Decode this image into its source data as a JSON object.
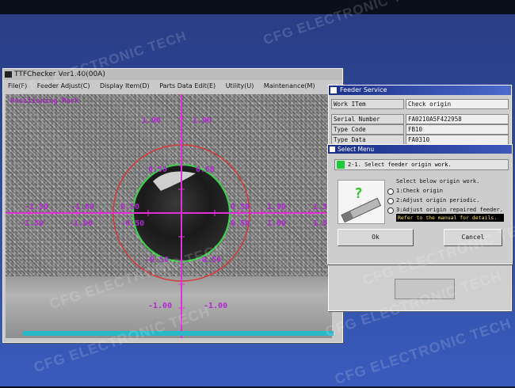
{
  "window": {
    "title": "TTFChecker Ver1.40(00A)",
    "menu": [
      "File(F)",
      "Feeder Adjust(C)",
      "Display Item(D)",
      "Parts Data Edit(E)",
      "Utility(U)",
      "Maintenance(M)"
    ]
  },
  "camera": {
    "title": "Positioning Mark",
    "labels": {
      "top_left": "1.00",
      "top_right": "1.00",
      "inner_ul": "0.50",
      "inner_ur": "0.50",
      "mid_l2": "0.50",
      "mid_r1": "0.50",
      "far_l": "-1.50",
      "far_l2": "-1.00",
      "far_r1": "1.00",
      "far_r2": "1.50",
      "low_l2": "-1.50",
      "low_l1": "-1.00",
      "low_m1": "-0.50",
      "low_r1": "0.50",
      "low_r2": "1.00",
      "low_r3": "1.50",
      "inner_ll": "-0.50",
      "inner_lr": "-0.50",
      "bottom_l": "-1.00",
      "bottom_r": "-1.00"
    }
  },
  "feeder_service": {
    "title": "Feeder Service",
    "rows": [
      {
        "label": "Work ITem",
        "value": "Check origin"
      },
      {
        "label": "Serial Number",
        "value": "FA0210A5F422958"
      },
      {
        "label": "Type Code",
        "value": "FB10"
      },
      {
        "label": "Type Data",
        "value": "FA0310"
      }
    ]
  },
  "select_menu": {
    "title": "Select Menu",
    "step": "2-1. Select feeder origin work.",
    "prompt": "Select below origin work.",
    "options": [
      "1:Check origin",
      "2:Adjust origin periodic.",
      "3:Adjust origin repaired feeder."
    ],
    "hint": "Refer to the manual for details.",
    "ok_label": "Ok",
    "cancel_label": "Cancel"
  },
  "watermark": "CFG ELECTRONIC TECH"
}
